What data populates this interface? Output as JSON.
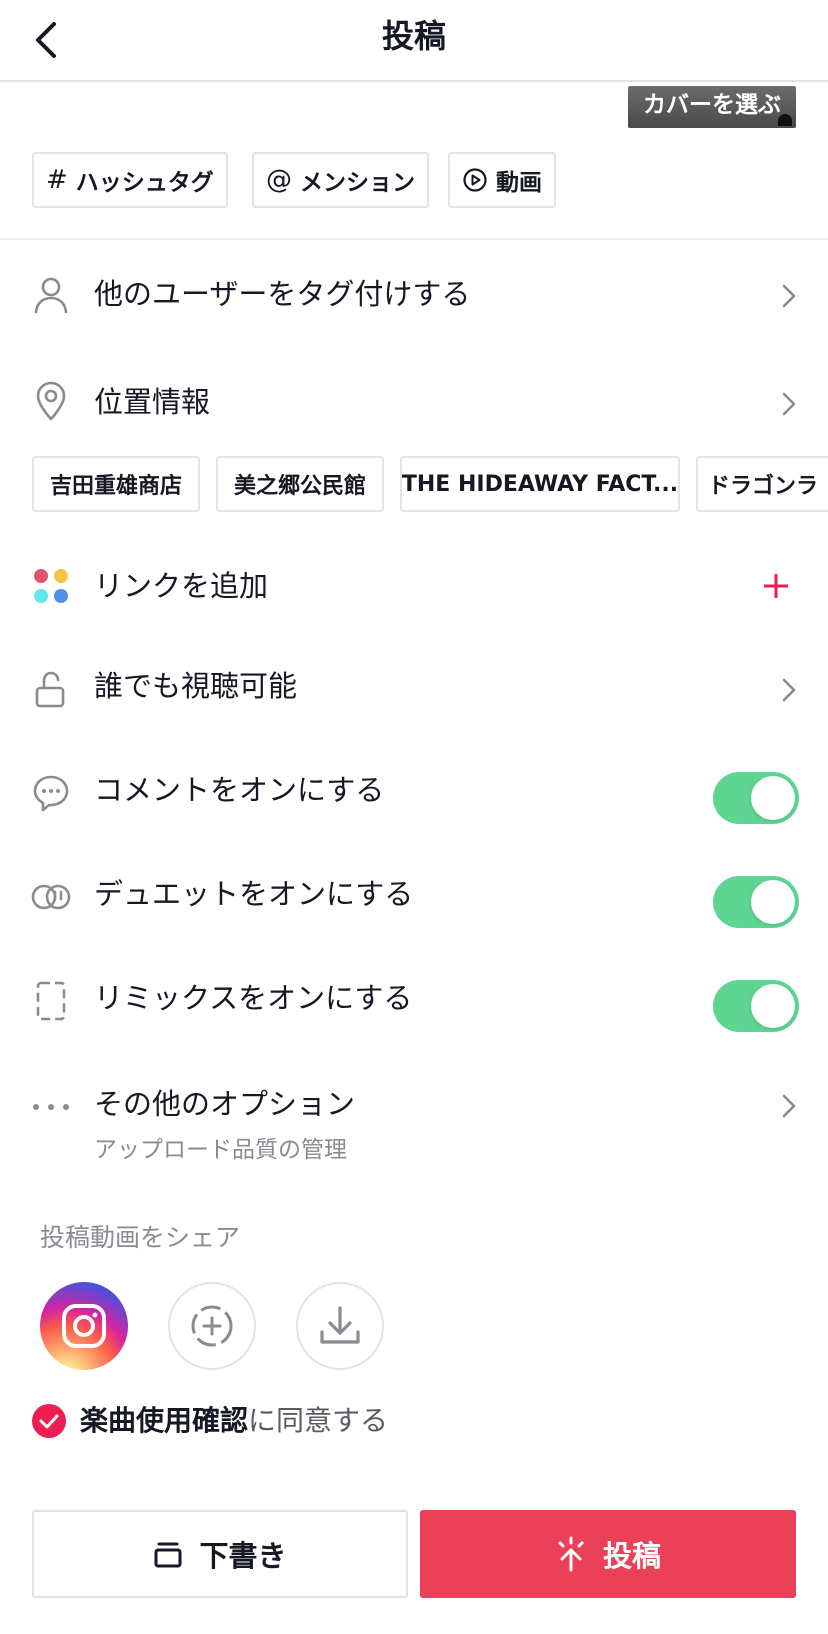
{
  "header": {
    "title": "投稿"
  },
  "cover": {
    "label": "カバーを選ぶ"
  },
  "tags": [
    {
      "icon": "hashtag-icon",
      "label": "ハッシュタグ"
    },
    {
      "icon": "at-icon",
      "label": "メンション"
    },
    {
      "icon": "play-circle-icon",
      "label": "動画"
    }
  ],
  "rows": {
    "tag_users": "他のユーザーをタグ付けする",
    "location": "位置情報",
    "add_link": "リンクを追加",
    "privacy": "誰でも視聴可能",
    "comments": "コメントをオンにする",
    "duet": "デュエットをオンにする",
    "remix": "リミックスをオンにする",
    "more_options": "その他のオプション",
    "more_options_sub": "アップロード品質の管理"
  },
  "locations": [
    "吉田重雄商店",
    "美之郷公民館",
    "THE HIDEAWAY FACT...",
    "ドラゴンラ"
  ],
  "toggles": {
    "comments": true,
    "duet": true,
    "remix": true
  },
  "share": {
    "title": "投稿動画をシェア"
  },
  "agree": {
    "bold": "楽曲使用確認",
    "rest": "に同意する",
    "checked": true
  },
  "buttons": {
    "draft": "下書き",
    "post": "投稿"
  },
  "colors": {
    "accent": "#ee1d52",
    "post": "#ea4058",
    "toggle": "#5ed592"
  }
}
